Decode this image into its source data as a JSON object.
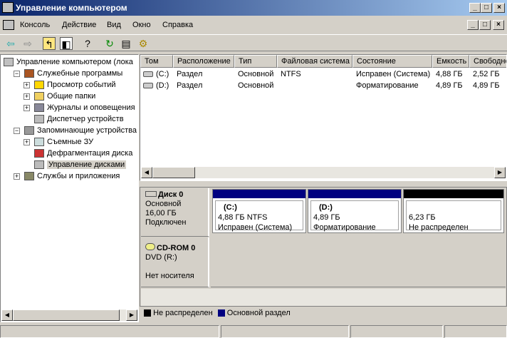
{
  "window": {
    "title": "Управление компьютером",
    "controls": [
      "_",
      "□",
      "×"
    ]
  },
  "menu": [
    "Консоль",
    "Действие",
    "Вид",
    "Окно",
    "Справка"
  ],
  "toolbar": [
    "back-icon",
    "forward-icon",
    "up-folder-icon",
    "show-hide-tree-icon",
    "help-icon",
    "refresh-icon",
    "properties-icon",
    "settings-icon"
  ],
  "tree": [
    {
      "label": "Управление компьютером (лока",
      "level": 0,
      "expander": ""
    },
    {
      "label": "Служебные программы",
      "level": 1,
      "expander": "−"
    },
    {
      "label": "Просмотр событий",
      "level": 2,
      "expander": "+"
    },
    {
      "label": "Общие папки",
      "level": 2,
      "expander": "+"
    },
    {
      "label": "Журналы и оповещения",
      "level": 2,
      "expander": "+"
    },
    {
      "label": "Диспетчер устройств",
      "level": 2,
      "expander": ""
    },
    {
      "label": "Запоминающие устройства",
      "level": 1,
      "expander": "−"
    },
    {
      "label": "Съемные ЗУ",
      "level": 2,
      "expander": "+"
    },
    {
      "label": "Дефрагментация диска",
      "level": 2,
      "expander": ""
    },
    {
      "label": "Управление дисками",
      "level": 2,
      "expander": "",
      "selected": true
    },
    {
      "label": "Службы и приложения",
      "level": 1,
      "expander": "+"
    }
  ],
  "list": {
    "columns": [
      "Том",
      "Расположение",
      "Тип",
      "Файловая система",
      "Состояние",
      "Емкость",
      "Свободно"
    ],
    "rows": [
      [
        "(C:)",
        "Раздел",
        "Основной",
        "NTFS",
        "Исправен (Система)",
        "4,88 ГБ",
        "2,52 ГБ"
      ],
      [
        "(D:)",
        "Раздел",
        "Основной",
        "",
        "Форматирование",
        "4,89 ГБ",
        "4,89 ГБ"
      ]
    ]
  },
  "disks": [
    {
      "name": "Диск 0",
      "type": "Основной",
      "size": "16,00 ГБ",
      "status": "Подключен",
      "partitions": [
        {
          "label": "(C:)",
          "size": "4,88 ГБ NTFS",
          "state": "Исправен (Система)",
          "color": "#000080"
        },
        {
          "label": "(D:)",
          "size": "4,89 ГБ",
          "state": "Форматирование",
          "color": "#000080"
        },
        {
          "label": "",
          "size": "6,23 ГБ",
          "state": "Не распределен",
          "color": "#000000"
        }
      ]
    },
    {
      "name": "CD-ROM 0",
      "type": "DVD (R:)",
      "size": "",
      "status": "Нет носителя"
    }
  ],
  "legend": [
    {
      "label": "Не распределен",
      "color": "#000000"
    },
    {
      "label": "Основной раздел",
      "color": "#000080"
    }
  ]
}
